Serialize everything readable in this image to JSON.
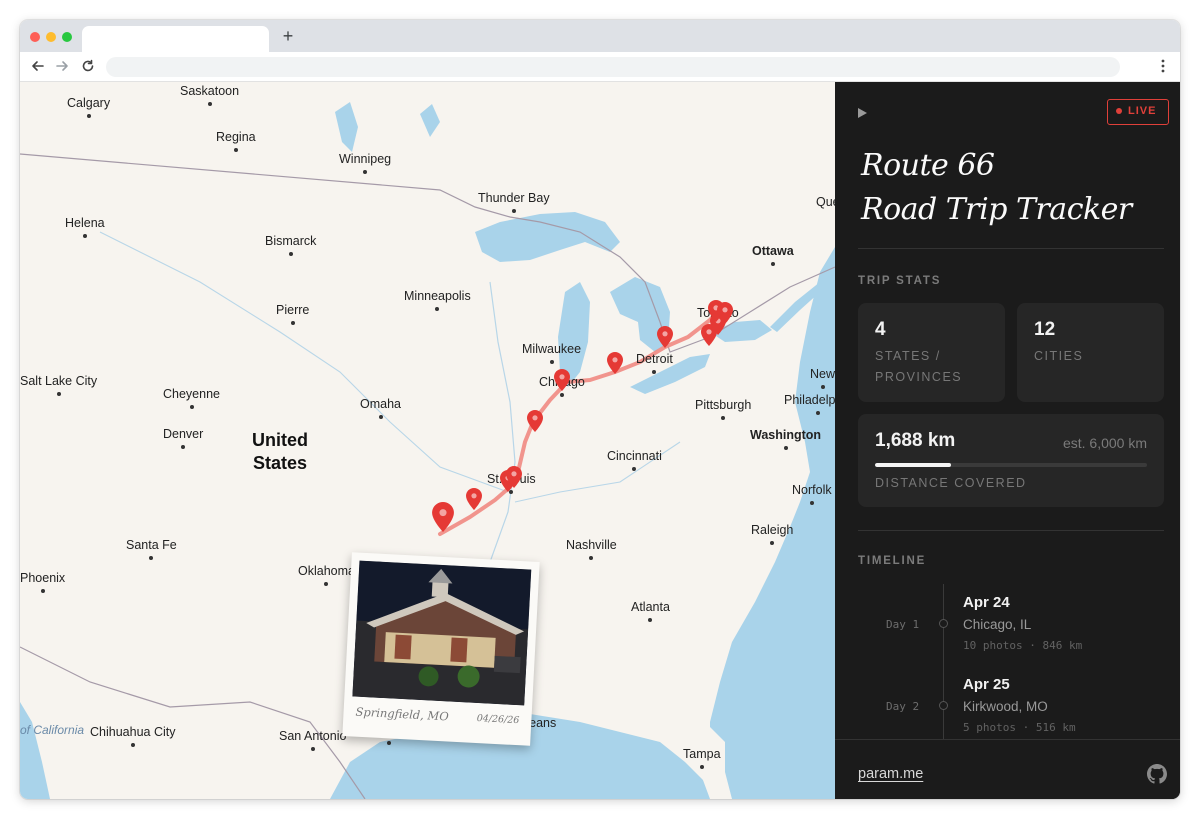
{
  "browser": {
    "new_tab_label": "+",
    "back_icon": "back-arrow-icon",
    "forward_icon": "forward-arrow-icon",
    "reload_icon": "reload-icon",
    "menu_icon": "kebab-menu-icon"
  },
  "map": {
    "country_label": "United States",
    "cities": [
      "Calgary",
      "Saskatoon",
      "Regina",
      "Winnipeg",
      "Thunder Bay",
      "Helena",
      "Bismarck",
      "Ottawa",
      "Minneapolis",
      "Pierre",
      "Milwaukee",
      "Detroit",
      "Toronto",
      "Chicago",
      "Salt Lake City",
      "Cheyenne",
      "Omaha",
      "Pittsburgh",
      "Philadelphia",
      "New",
      "Denver",
      "Washington",
      "Cincinnati",
      "St. Louis",
      "Norfolk",
      "Raleigh",
      "Nashville",
      "Santa Fe",
      "Oklahoma",
      "Phoenix",
      "Atlanta",
      "Chihuahua City",
      "San Antonio",
      "Houston",
      "New Orleans",
      "Tampa",
      "Quebec"
    ],
    "gulf_label": "of California",
    "marker_color": "#e53935",
    "route_color": "#f08a82",
    "water_color": "#a9d3ea"
  },
  "polaroid": {
    "place": "Springfield, MO",
    "date": "04/26/26"
  },
  "panel": {
    "play_icon": "play-icon",
    "live_label": "LIVE",
    "title_line1": "Route 66",
    "title_line2": "Road Trip Tracker",
    "stats_title": "TRIP STATS",
    "states_value": "4",
    "states_label": "STATES / PROVINCES",
    "cities_value": "12",
    "cities_label": "CITIES",
    "distance_value": "1,688 km",
    "distance_estimate": "est. 6,000 km",
    "distance_label": "DISTANCE COVERED",
    "distance_progress": 0.281,
    "timeline_title": "TIMELINE",
    "timeline": [
      {
        "day": "Day 1",
        "date": "Apr 24",
        "place": "Chicago, IL",
        "meta": "10 photos · 846 km"
      },
      {
        "day": "Day 2",
        "date": "Apr 25",
        "place": "Kirkwood, MO",
        "meta": "5 photos · 516 km"
      }
    ],
    "footer_link": "param.me",
    "github_icon": "github-icon",
    "accent_color": "#e0403a",
    "background_color": "#1b1b1b"
  }
}
